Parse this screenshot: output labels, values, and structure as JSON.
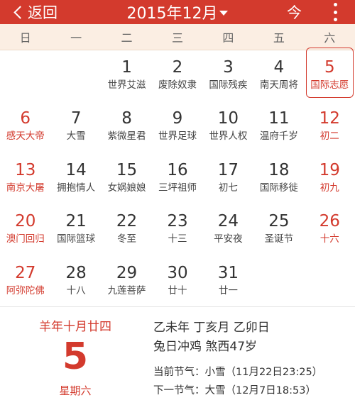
{
  "header": {
    "back_label": "返回",
    "month_title": "2015年12月",
    "today_label": "今"
  },
  "weekdays": [
    "日",
    "一",
    "二",
    "三",
    "四",
    "五",
    "六"
  ],
  "weeks": [
    [
      null,
      null,
      {
        "day": "1",
        "lunar": "世界艾滋",
        "festival": false
      },
      {
        "day": "2",
        "lunar": "废除奴隶",
        "festival": false
      },
      {
        "day": "3",
        "lunar": "国际残疾",
        "festival": false
      },
      {
        "day": "4",
        "lunar": "南天周将",
        "festival": false
      },
      {
        "day": "5",
        "lunar": "国际志愿",
        "festival": false,
        "selected": true
      }
    ],
    [
      {
        "day": "6",
        "lunar": "感天大帝",
        "festival": false
      },
      {
        "day": "7",
        "lunar": "大雪",
        "festival": false
      },
      {
        "day": "8",
        "lunar": "紫微星君",
        "festival": false
      },
      {
        "day": "9",
        "lunar": "世界足球",
        "festival": false
      },
      {
        "day": "10",
        "lunar": "世界人权",
        "festival": false
      },
      {
        "day": "11",
        "lunar": "温府千岁",
        "festival": false
      },
      {
        "day": "12",
        "lunar": "初二",
        "festival": false
      }
    ],
    [
      {
        "day": "13",
        "lunar": "南京大屠",
        "festival": false
      },
      {
        "day": "14",
        "lunar": "拥抱情人",
        "festival": false
      },
      {
        "day": "15",
        "lunar": "女娲娘娘",
        "festival": false
      },
      {
        "day": "16",
        "lunar": "三坪祖师",
        "festival": false
      },
      {
        "day": "17",
        "lunar": "初七",
        "festival": false
      },
      {
        "day": "18",
        "lunar": "国际移徙",
        "festival": false
      },
      {
        "day": "19",
        "lunar": "初九",
        "festival": false
      }
    ],
    [
      {
        "day": "20",
        "lunar": "澳门回归",
        "festival": false
      },
      {
        "day": "21",
        "lunar": "国际篮球",
        "festival": false
      },
      {
        "day": "22",
        "lunar": "冬至",
        "festival": false
      },
      {
        "day": "23",
        "lunar": "十三",
        "festival": false
      },
      {
        "day": "24",
        "lunar": "平安夜",
        "festival": false
      },
      {
        "day": "25",
        "lunar": "圣诞节",
        "festival": false
      },
      {
        "day": "26",
        "lunar": "十六",
        "festival": false
      }
    ],
    [
      {
        "day": "27",
        "lunar": "阿弥陀佛",
        "festival": false
      },
      {
        "day": "28",
        "lunar": "十八",
        "festival": false
      },
      {
        "day": "29",
        "lunar": "九莲菩萨",
        "festival": false
      },
      {
        "day": "30",
        "lunar": "廿十",
        "festival": false
      },
      {
        "day": "31",
        "lunar": "廿一",
        "festival": false
      },
      null,
      null
    ]
  ],
  "detail": {
    "lunar_date": "羊年十月廿四",
    "day": "5",
    "weekday": "星期六",
    "ganzhi": "乙未年 丁亥月 乙卯日",
    "chong": "兔日冲鸡 煞西47岁",
    "current_jieqi": "当前节气：小雪（11月22日23:25）",
    "next_jieqi": "下一节气：大雪（12月7日18:53）"
  },
  "colors": {
    "accent": "#d33a2d",
    "weekbar_bg": "#fbeee3"
  },
  "icons": {
    "back": "chevron-left-icon",
    "month": "caret-down-icon",
    "more": "more-vertical-icon"
  }
}
